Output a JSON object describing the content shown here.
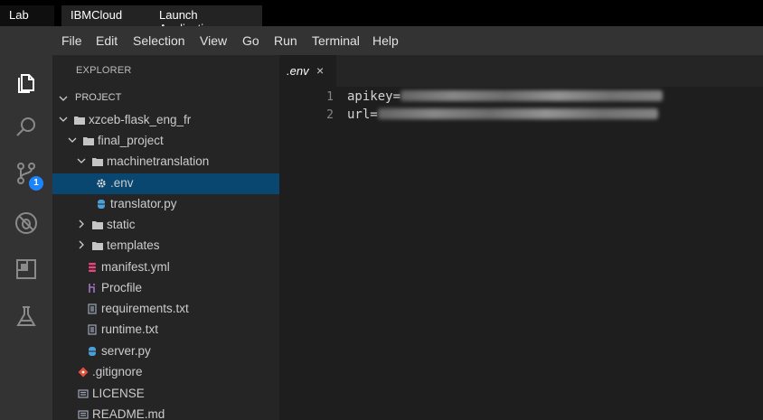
{
  "top_tabs": [
    "Lab",
    "IBMCloud",
    "Launch Application"
  ],
  "menu": [
    "File",
    "Edit",
    "Selection",
    "View",
    "Go",
    "Run",
    "Terminal",
    "Help"
  ],
  "activity_bar": {
    "icons": [
      "files-icon",
      "search-icon",
      "source-control-icon",
      "debug-icon",
      "extensions-icon",
      "lab-flask-icon"
    ],
    "scm_badge": "1"
  },
  "explorer": {
    "title": "EXPLORER",
    "section": "PROJECT",
    "tree": [
      {
        "label": "xzceb-flask_eng_fr",
        "type": "folder",
        "expanded": true
      },
      {
        "label": "final_project",
        "type": "folder",
        "expanded": true
      },
      {
        "label": "machinetranslation",
        "type": "folder",
        "expanded": true
      },
      {
        "label": ".env",
        "type": "gear-file",
        "selected": true
      },
      {
        "label": "translator.py",
        "type": "python-file"
      },
      {
        "label": "static",
        "type": "folder",
        "expanded": false
      },
      {
        "label": "templates",
        "type": "folder",
        "expanded": false
      },
      {
        "label": "manifest.yml",
        "type": "yaml-file"
      },
      {
        "label": "Procfile",
        "type": "heroku-file"
      },
      {
        "label": "requirements.txt",
        "type": "text-file"
      },
      {
        "label": "runtime.txt",
        "type": "text-file"
      },
      {
        "label": "server.py",
        "type": "python-file"
      },
      {
        "label": ".gitignore",
        "type": "git-file"
      },
      {
        "label": "LICENSE",
        "type": "license-file"
      },
      {
        "label": "README.md",
        "type": "markdown-file"
      }
    ]
  },
  "editor": {
    "tab_name": ".env",
    "close_glyph": "×",
    "lines": [
      {
        "number": "1",
        "text": "apikey="
      },
      {
        "number": "2",
        "text": "url="
      }
    ]
  },
  "colors": {
    "selection": "#094771",
    "badge": "#1a85ff",
    "folder": "#c5c5c5",
    "python": "#4a9fd8",
    "yaml": "#e8457a",
    "git": "#e0503a"
  }
}
